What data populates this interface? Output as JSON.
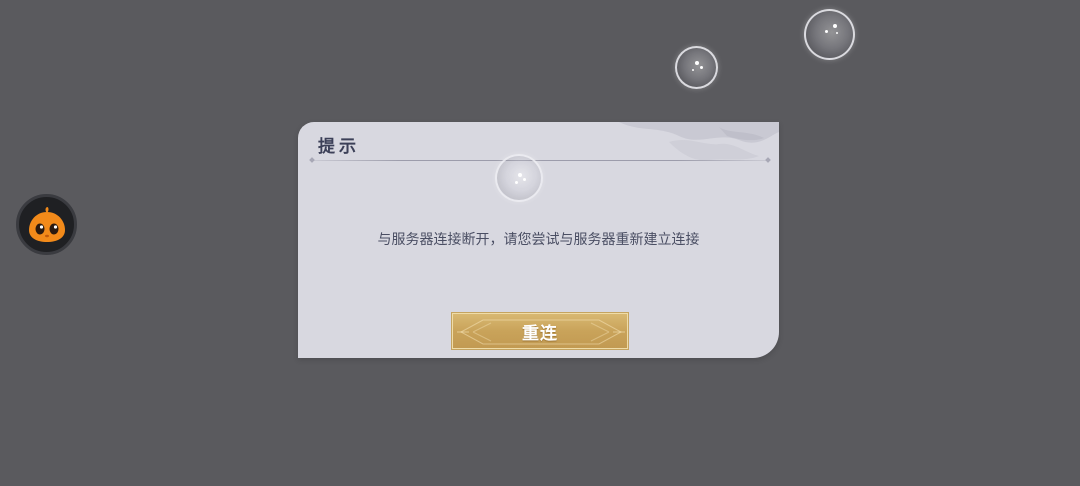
{
  "dialog": {
    "title": "提示",
    "message": "与服务器连接断开，请您尝试与服务器重新建立连接",
    "reconnect_label": "重连"
  },
  "mascot": {
    "icon": "orange-blob-mascot-icon"
  },
  "colors": {
    "background": "#5a5a5e",
    "dialog_bg": "#d8d8e0",
    "title_text": "#3c4058",
    "message_text": "#4a4e63",
    "button_gold": "#c9a35a",
    "mascot_orange": "#f28a1a"
  }
}
